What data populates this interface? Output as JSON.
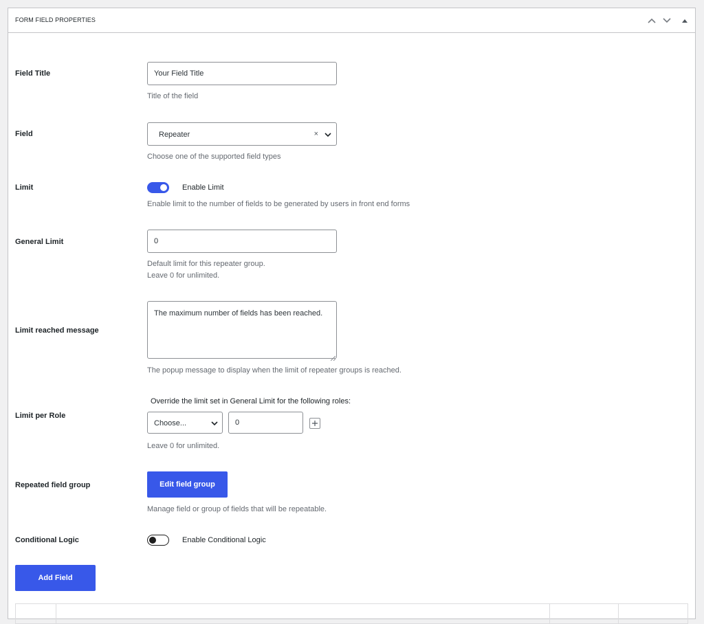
{
  "panel": {
    "title": "FORM FIELD PROPERTIES"
  },
  "fields": {
    "field_title": {
      "label": "Field Title",
      "value": "Your Field Title",
      "description": "Title of the field"
    },
    "field_type": {
      "label": "Field",
      "selected": "Repeater",
      "clear_symbol": "×",
      "description": "Choose one of the supported field types"
    },
    "limit": {
      "label": "Limit",
      "toggle_label": "Enable Limit",
      "enabled": true,
      "description": "Enable limit to the number of fields to be generated by users in front end forms"
    },
    "general_limit": {
      "label": "General Limit",
      "value": "0",
      "description_line1": "Default limit for this repeater group.",
      "description_line2": "Leave 0 for unlimited."
    },
    "limit_message": {
      "label": "Limit reached message",
      "value": "The maximum number of fields has been reached.",
      "description": "The popup message to display when the limit of repeater groups is reached."
    },
    "limit_per_role": {
      "label": "Limit per Role",
      "note": "Override the limit set in General Limit for the following roles:",
      "role_selected": "Choose...",
      "role_value": "0",
      "description": "Leave 0 for unlimited."
    },
    "repeated_group": {
      "label": "Repeated field group",
      "button_label": "Edit field group",
      "description": "Manage field or group of fields that will be repeatable."
    },
    "conditional_logic": {
      "label": "Conditional Logic",
      "toggle_label": "Enable Conditional Logic",
      "enabled": false
    }
  },
  "actions": {
    "add_field_label": "Add Field"
  },
  "colors": {
    "accent": "#3858e9",
    "border": "#8c8f94",
    "muted_text": "#646970"
  }
}
